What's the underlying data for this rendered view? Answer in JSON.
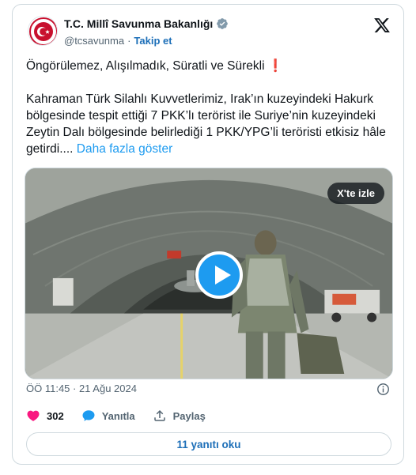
{
  "account": {
    "name": "T.C. Millî Savunma Bakanlığı",
    "handle": "@tcsavunma",
    "separator": "·",
    "follow_label": "Takip et"
  },
  "tweet": {
    "headline": "Öngörülemez, Alışılmadık, Süratli ve Sürekli",
    "headline_emoji": "❗",
    "body": "Kahraman Türk Silahlı Kuvvetlerimiz, Irak’ın kuzeyindeki Hakurk bölgesinde tespit ettiği 7 PKK’lı terörist ile Suriye’nin kuzeyindeki Zeytin Dalı bölgesinde belirlediği 1 PKK/YPG’li teröristi etkisiz hâle getirdi....",
    "show_more": "Daha fazla göster"
  },
  "media": {
    "watch_label": "X'te izle"
  },
  "meta": {
    "timestamp": "ÖÖ 11:45 · 21 Ağu 2024"
  },
  "actions": {
    "like_count": "302",
    "reply_label": "Yanıtla",
    "share_label": "Paylaş"
  },
  "replies_button": "11 yanıtı oku",
  "colors": {
    "accent": "#1d9bf0",
    "link": "#1d6fb8",
    "like": "#f91880",
    "verified": "#829aab"
  }
}
